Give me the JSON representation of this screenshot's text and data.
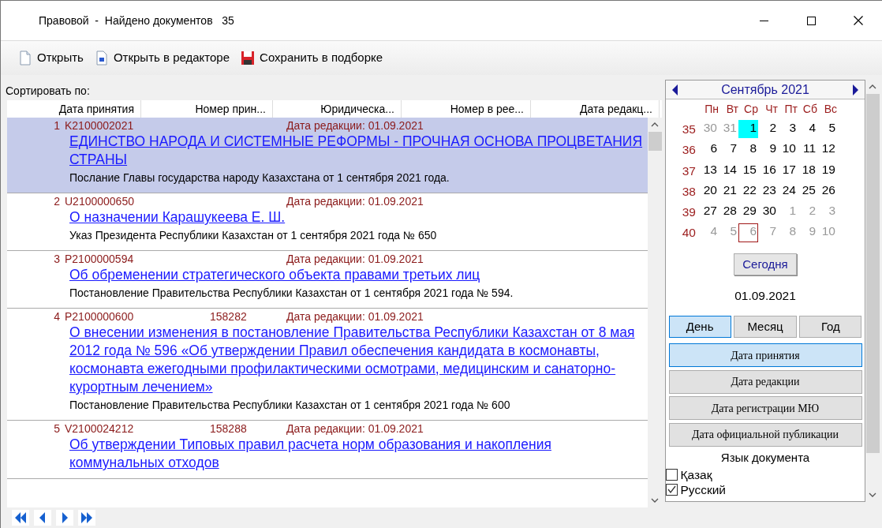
{
  "window": {
    "title": "Правовой  -  Найдено документов   35"
  },
  "toolbar": [
    {
      "label": "Открыть",
      "kind": "open"
    },
    {
      "label": "Открыть в редакторе",
      "kind": "editor"
    },
    {
      "label": "Сохранить в подборке",
      "kind": "save"
    }
  ],
  "sort_label": "Сортировать по:",
  "columns": [
    "Дата принятия",
    "Номер прин...",
    "Юридическа...",
    "Номер в рее...",
    "Дата редакц..."
  ],
  "documents": [
    {
      "number": "1",
      "code": "K2100002021",
      "edition": "Дата редакции: 01.09.2021",
      "title": "ЕДИНСТВО НАРОДА И СИСТЕМНЫЕ РЕФОРМЫ - ПРОЧНАЯ ОСНОВА ПРОЦВЕТАНИЯ СТРАНЫ ",
      "description": "Послание Главы государства народу Казахстана от 1 сентября 2021 года.",
      "selected": true
    },
    {
      "number": "2",
      "code": "U2100000650",
      "edition": "Дата редакции: 01.09.2021",
      "title": "О назначении Карашукеева Е. Ш. ",
      "description": "Указ Президента Республики Казахстан от 1 сентября 2021 года № 650",
      "selected": false
    },
    {
      "number": "3",
      "code": "P2100000594",
      "edition": "Дата редакции: 01.09.2021",
      "title": "Об обременении стратегического объекта правами третьих лиц ",
      "description": "Постановление Правительства Республики Казахстан от 1 сентября 2021 года № 594.",
      "selected": false
    },
    {
      "number": "4",
      "code": "P2100000600",
      "reg_number": "158282",
      "edition": "Дата редакции: 01.09.2021",
      "title": "О внесении изменения в постановление Правительства Республики Казахстан от 8 мая 2012 года № 596 «Об утверждении Правил обеспечения кандидата в космонавты, космонавта ежегодными профилактическими осмотрами, медицинским и санаторно-курортным лечением» ",
      "description": "Постановление Правительства Республики Казахстан от 1 сентября 2021 года № 600",
      "selected": false
    },
    {
      "number": "5",
      "code": "V2100024212",
      "reg_number": "158288",
      "edition": "Дата редакции: 01.09.2021",
      "title": "Об утверждении Типовых правил расчета норм образования и накопления коммунальных отходов",
      "selected": false
    }
  ],
  "calendar": {
    "month": "Сентябрь 2021",
    "weekdays": [
      "Пн",
      "Вт",
      "Ср",
      "Чт",
      "Пт",
      "Сб",
      "Вс"
    ],
    "weeks": [
      {
        "week": "35",
        "days": [
          {
            "day": "30",
            "other_month": true,
            "selected": false
          },
          {
            "day": "31",
            "other_month": true,
            "selected": false
          },
          {
            "day": "1",
            "other_month": false,
            "selected": true
          },
          {
            "day": "2",
            "other_month": false,
            "selected": false
          },
          {
            "day": "3",
            "other_month": false,
            "selected": false
          },
          {
            "day": "4",
            "other_month": false,
            "selected": false
          },
          {
            "day": "5",
            "other_month": false,
            "selected": false
          }
        ]
      },
      {
        "week": "36",
        "days": [
          {
            "day": "6",
            "other_month": false,
            "selected": false
          },
          {
            "day": "7",
            "other_month": false,
            "selected": false
          },
          {
            "day": "8",
            "other_month": false,
            "selected": false
          },
          {
            "day": "9",
            "other_month": false,
            "selected": false
          },
          {
            "day": "10",
            "other_month": false,
            "selected": false
          },
          {
            "day": "11",
            "other_month": false,
            "selected": false
          },
          {
            "day": "12",
            "other_month": false,
            "selected": false
          }
        ]
      },
      {
        "week": "37",
        "days": [
          {
            "day": "13",
            "other_month": false,
            "selected": false
          },
          {
            "day": "14",
            "other_month": false,
            "selected": false
          },
          {
            "day": "15",
            "other_month": false,
            "selected": false
          },
          {
            "day": "16",
            "other_month": false,
            "selected": false
          },
          {
            "day": "17",
            "other_month": false,
            "selected": false
          },
          {
            "day": "18",
            "other_month": false,
            "selected": false
          },
          {
            "day": "19",
            "other_month": false,
            "selected": false
          }
        ]
      },
      {
        "week": "38",
        "days": [
          {
            "day": "20",
            "other_month": false,
            "selected": false
          },
          {
            "day": "21",
            "other_month": false,
            "selected": false
          },
          {
            "day": "22",
            "other_month": false,
            "selected": false
          },
          {
            "day": "23",
            "other_month": false,
            "selected": false
          },
          {
            "day": "24",
            "other_month": false,
            "selected": false
          },
          {
            "day": "25",
            "other_month": false,
            "selected": false
          },
          {
            "day": "26",
            "other_month": false,
            "selected": false
          }
        ]
      },
      {
        "week": "39",
        "days": [
          {
            "day": "27",
            "other_month": false,
            "selected": false
          },
          {
            "day": "28",
            "other_month": false,
            "selected": false
          },
          {
            "day": "29",
            "other_month": false,
            "selected": false
          },
          {
            "day": "30",
            "other_month": false,
            "selected": false
          },
          {
            "day": "1",
            "other_month": true,
            "selected": false
          },
          {
            "day": "2",
            "other_month": true,
            "selected": false
          },
          {
            "day": "3",
            "other_month": true,
            "selected": false
          }
        ]
      },
      {
        "week": "40",
        "days": [
          {
            "day": "4",
            "other_month": true,
            "selected": false
          },
          {
            "day": "5",
            "other_month": true,
            "selected": false
          },
          {
            "day": "6",
            "other_month": true,
            "selected": false,
            "today": true
          },
          {
            "day": "7",
            "other_month": true,
            "selected": false
          },
          {
            "day": "8",
            "other_month": true,
            "selected": false
          },
          {
            "day": "9",
            "other_month": true,
            "selected": false
          },
          {
            "day": "10",
            "other_month": true,
            "selected": false
          }
        ]
      }
    ]
  },
  "today_button": "Сегодня",
  "current_date": "01.09.2021",
  "periods": [
    {
      "label": "День",
      "selected": true
    },
    {
      "label": "Месяц",
      "selected": false
    },
    {
      "label": "Год",
      "selected": false
    }
  ],
  "date_types": [
    {
      "label": "Дата принятия",
      "selected": true
    },
    {
      "label": "Дата редакции",
      "selected": false
    },
    {
      "label": "Дата регистрации МЮ",
      "selected": false
    },
    {
      "label": "Дата официальной публикации",
      "selected": false
    }
  ],
  "language": {
    "title": "Язык документа",
    "options": [
      {
        "label": "Қазақ",
        "checked": false
      },
      {
        "label": "Русский",
        "checked": true
      }
    ]
  }
}
